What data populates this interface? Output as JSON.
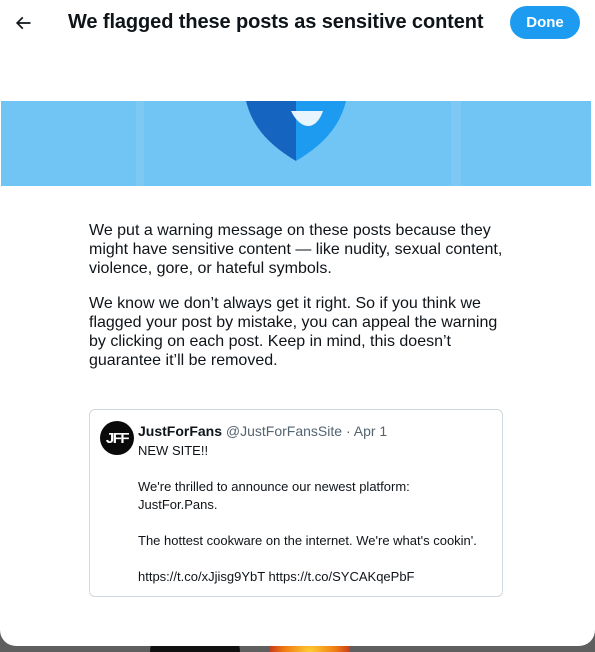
{
  "header": {
    "title": "We flagged these posts as sensitive content",
    "done_label": "Done"
  },
  "body": {
    "paragraph1": "We put a warning message on these posts because they might have sensitive content — like nudity, sexual content, violence, gore, or hateful symbols.",
    "paragraph2": "We know we don’t always get it right. So if you think we flagged your post by mistake, you can appeal the warning by clicking on each post. Keep in mind, this doesn’t guarantee it’ll be removed."
  },
  "tweet": {
    "avatar_text": "JFF",
    "name": "JustForFans",
    "handle": "@JustForFansSite",
    "separator": "·",
    "date": "Apr 1",
    "lines": [
      "NEW SITE!!",
      "We're thrilled to announce our newest platform:",
      "JustFor.Pans.",
      "The hottest cookware on the internet. We're what's cookin'.",
      "https://t.co/xJjisg9YbT https://t.co/SYCAKqePbF"
    ]
  },
  "colors": {
    "accent": "#1d9bf0",
    "banner": "#71c5f5",
    "shield_dark": "#1565c0",
    "shield_light": "#1d9bf0"
  },
  "icons": {
    "back": "arrow-left-icon",
    "shield": "shield-icon"
  }
}
